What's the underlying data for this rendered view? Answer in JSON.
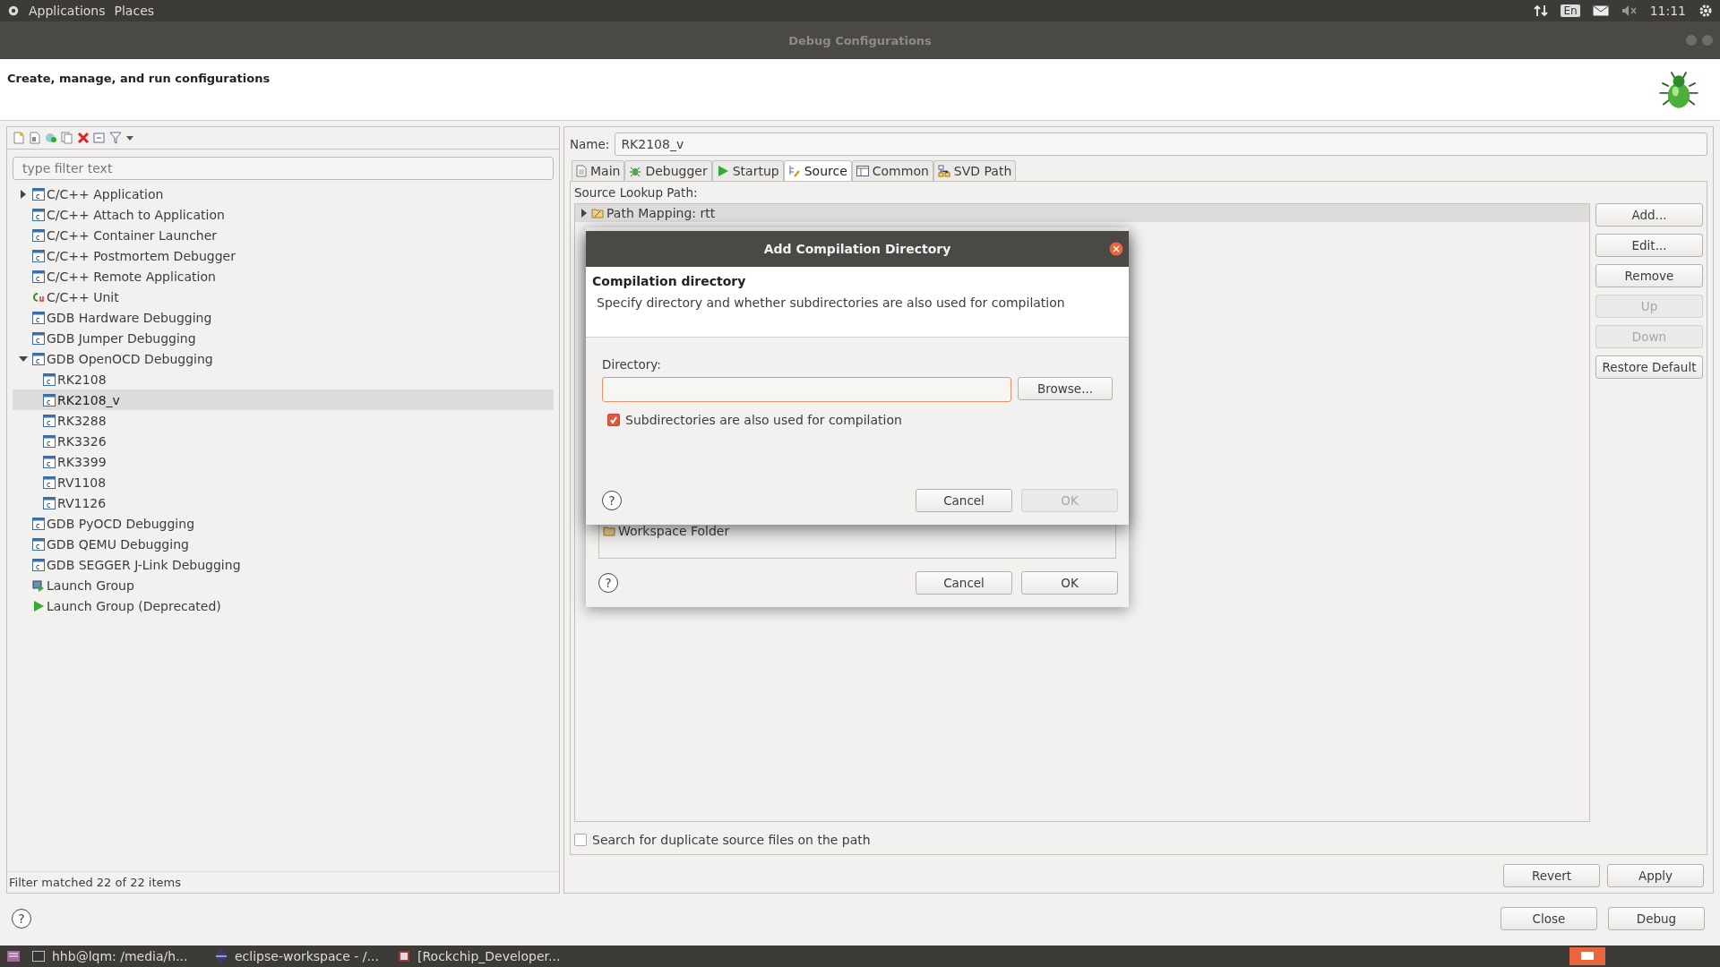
{
  "top_panel": {
    "menus": [
      "Applications",
      "Places"
    ],
    "keyboard": "En",
    "time": "11:11"
  },
  "window": {
    "title": "Debug Configurations",
    "header": "Create, manage, and run configurations"
  },
  "left": {
    "filter_placeholder": "type filter text",
    "tree": [
      {
        "label": "C/C++ Application",
        "kind": "c",
        "expanded": false,
        "selected": false
      },
      {
        "label": "C/C++ Attach to Application",
        "kind": "c",
        "selected": false
      },
      {
        "label": "C/C++ Container Launcher",
        "kind": "c",
        "selected": false
      },
      {
        "label": "C/C++ Postmortem Debugger",
        "kind": "c",
        "selected": false
      },
      {
        "label": "C/C++ Remote Application",
        "kind": "c",
        "selected": false
      },
      {
        "label": "C/C++ Unit",
        "kind": "unit",
        "selected": false
      },
      {
        "label": "GDB Hardware Debugging",
        "kind": "c",
        "selected": false
      },
      {
        "label": "GDB Jumper Debugging",
        "kind": "c",
        "selected": false
      },
      {
        "label": "GDB OpenOCD Debugging",
        "kind": "c",
        "expanded": true,
        "selected": false,
        "children": [
          {
            "label": "RK2108",
            "kind": "c",
            "selected": false
          },
          {
            "label": "RK2108_v",
            "kind": "c",
            "selected": true
          },
          {
            "label": "RK3288",
            "kind": "c",
            "selected": false
          },
          {
            "label": "RK3326",
            "kind": "c",
            "selected": false
          },
          {
            "label": "RK3399",
            "kind": "c",
            "selected": false
          },
          {
            "label": "RV1108",
            "kind": "c",
            "selected": false
          },
          {
            "label": "RV1126",
            "kind": "c",
            "selected": false
          }
        ]
      },
      {
        "label": "GDB PyOCD Debugging",
        "kind": "c",
        "selected": false
      },
      {
        "label": "GDB QEMU Debugging",
        "kind": "c",
        "selected": false
      },
      {
        "label": "GDB SEGGER J-Link Debugging",
        "kind": "c",
        "selected": false
      },
      {
        "label": "Launch Group",
        "kind": "group",
        "selected": false
      },
      {
        "label": "Launch Group (Deprecated)",
        "kind": "play",
        "selected": false
      }
    ],
    "status": "Filter matched 22 of 22 items"
  },
  "editor": {
    "name_label": "Name:",
    "name_value": "RK2108_v",
    "tabs": [
      {
        "label": "Main",
        "kind": "main",
        "selected": false
      },
      {
        "label": "Debugger",
        "kind": "debugger",
        "selected": false
      },
      {
        "label": "Startup",
        "kind": "startup",
        "selected": false
      },
      {
        "label": "Source",
        "kind": "source",
        "selected": true
      },
      {
        "label": "Common",
        "kind": "common",
        "selected": false
      },
      {
        "label": "SVD Path",
        "kind": "svd",
        "selected": false
      }
    ],
    "source_label": "Source Lookup Path:",
    "entries": [
      {
        "label": "Path Mapping: rtt",
        "expanded": false
      }
    ],
    "side_buttons": [
      {
        "label": "Add...",
        "disabled": false
      },
      {
        "label": "Edit...",
        "disabled": false
      },
      {
        "label": "Remove",
        "disabled": false
      },
      {
        "label": "Up",
        "disabled": true
      },
      {
        "label": "Down",
        "disabled": true
      },
      {
        "label": "Restore Default",
        "disabled": false
      }
    ],
    "duplicate_check": {
      "label": "Search for duplicate source files on the path",
      "checked": false
    },
    "buttons": [
      "Revert",
      "Apply"
    ]
  },
  "footer_help": "?",
  "footer_buttons": [
    "Close",
    "Debug"
  ],
  "taskbar": [
    {
      "label": "hhb@lqm: /media/h...",
      "kind": "terminal"
    },
    {
      "label": "eclipse-workspace - /...",
      "kind": "eclipse"
    },
    {
      "label": "[Rockchip_Developer...",
      "kind": "document"
    }
  ],
  "back_dialog": {
    "help": "?",
    "entries": [
      "Workspace Folder"
    ],
    "buttons": [
      {
        "label": "Cancel",
        "disabled": false
      },
      {
        "label": "OK",
        "disabled": false
      }
    ]
  },
  "dialog": {
    "help": "?",
    "title": "Add Compilation Directory",
    "heading": "Compilation directory",
    "description": "Specify directory and whether subdirectories are also used for compilation",
    "directory_label": "Directory:",
    "browse": "Browse...",
    "subdirs": {
      "label": "Subdirectories are also used for compilation",
      "checked": true
    },
    "buttons": [
      {
        "label": "Cancel",
        "disabled": false
      },
      {
        "label": "OK",
        "disabled": true
      }
    ]
  }
}
